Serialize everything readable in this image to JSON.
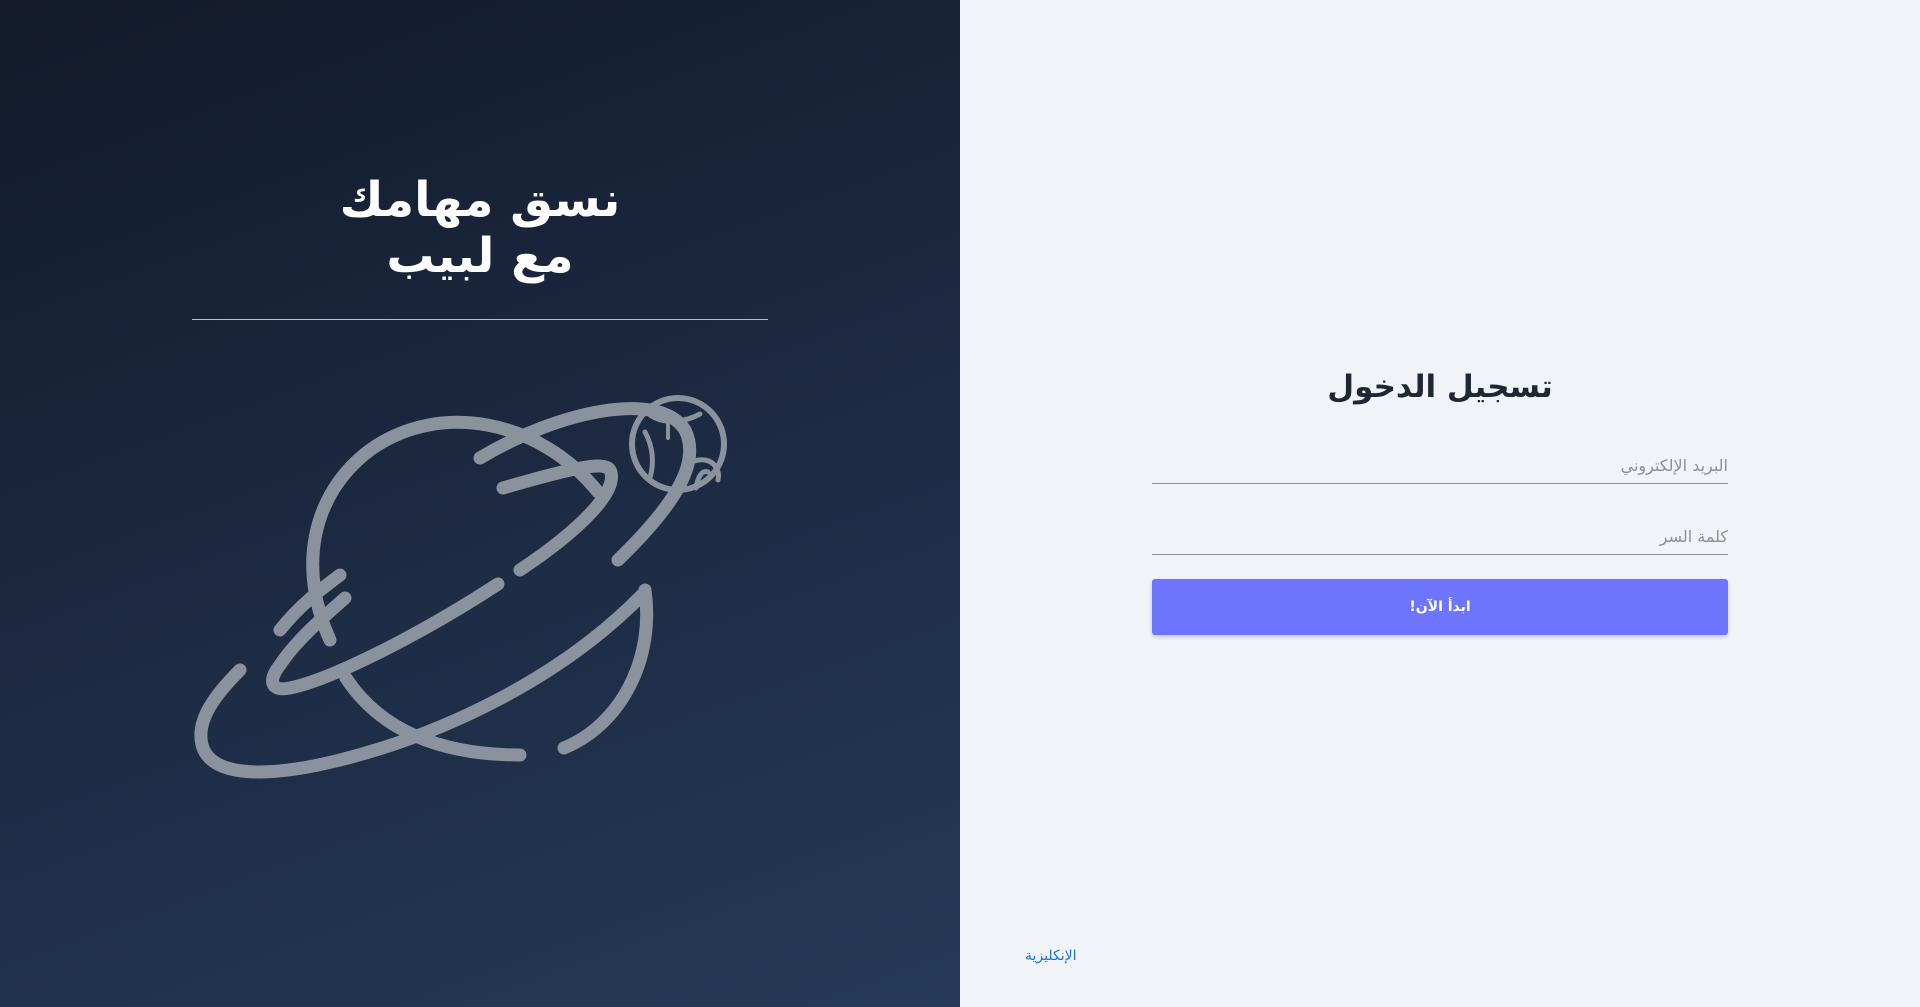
{
  "login": {
    "title": "تسجيل الدخول",
    "email_placeholder": "البريد الإلكتروني",
    "password_placeholder": "كلمة السر",
    "submit_label": "ابدأ الآن!",
    "language_link": "الإنكليزية"
  },
  "hero": {
    "title_line1": "نسق مهامك",
    "title_line2": "مع لبيب",
    "illustration": "planet-icon",
    "colors": {
      "background_start": "#121a2b",
      "background_end": "#253a57",
      "illustration_stroke": "#8a929e"
    }
  },
  "colors": {
    "login_background": "#f0f4f8",
    "primary_button": "#6c75fc",
    "link": "#1a73c9"
  }
}
